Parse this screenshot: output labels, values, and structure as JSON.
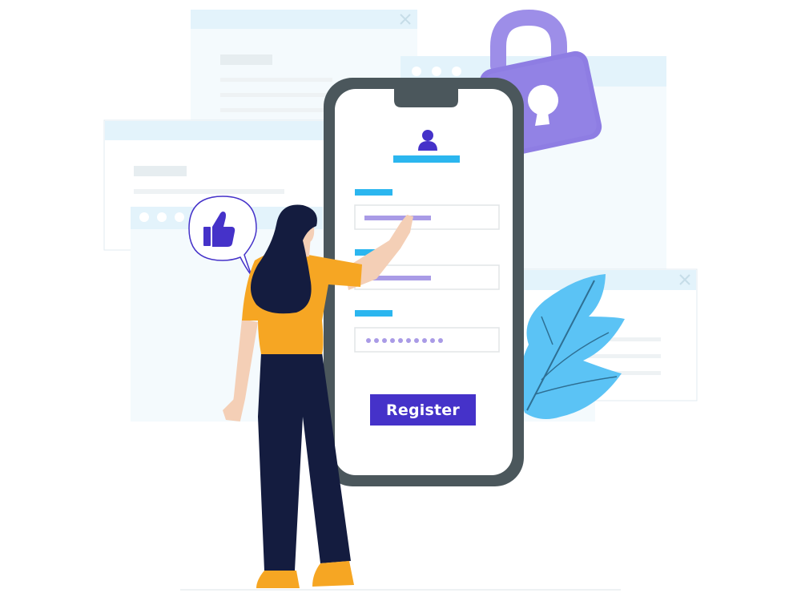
{
  "register_button": {
    "label": "Register"
  },
  "password_field": {
    "mask": "●●●●●●●●●●"
  },
  "icons": {
    "user": "user-icon",
    "thumbs_up": "thumbs-up-icon",
    "padlock": "padlock-icon",
    "close": "close-icon",
    "leaf": "leaf-icon"
  },
  "colors": {
    "primary": "#4532c9",
    "accent_blue": "#2bb6ef",
    "lavender": "#a99be6",
    "lock_purple": "#8e7de3",
    "shirt_orange": "#f6a623",
    "pants_navy": "#141c3f",
    "phone_frame": "#4b575c",
    "window_bar": "#e3f3fb",
    "leaf_blue": "#5bc3f5"
  }
}
